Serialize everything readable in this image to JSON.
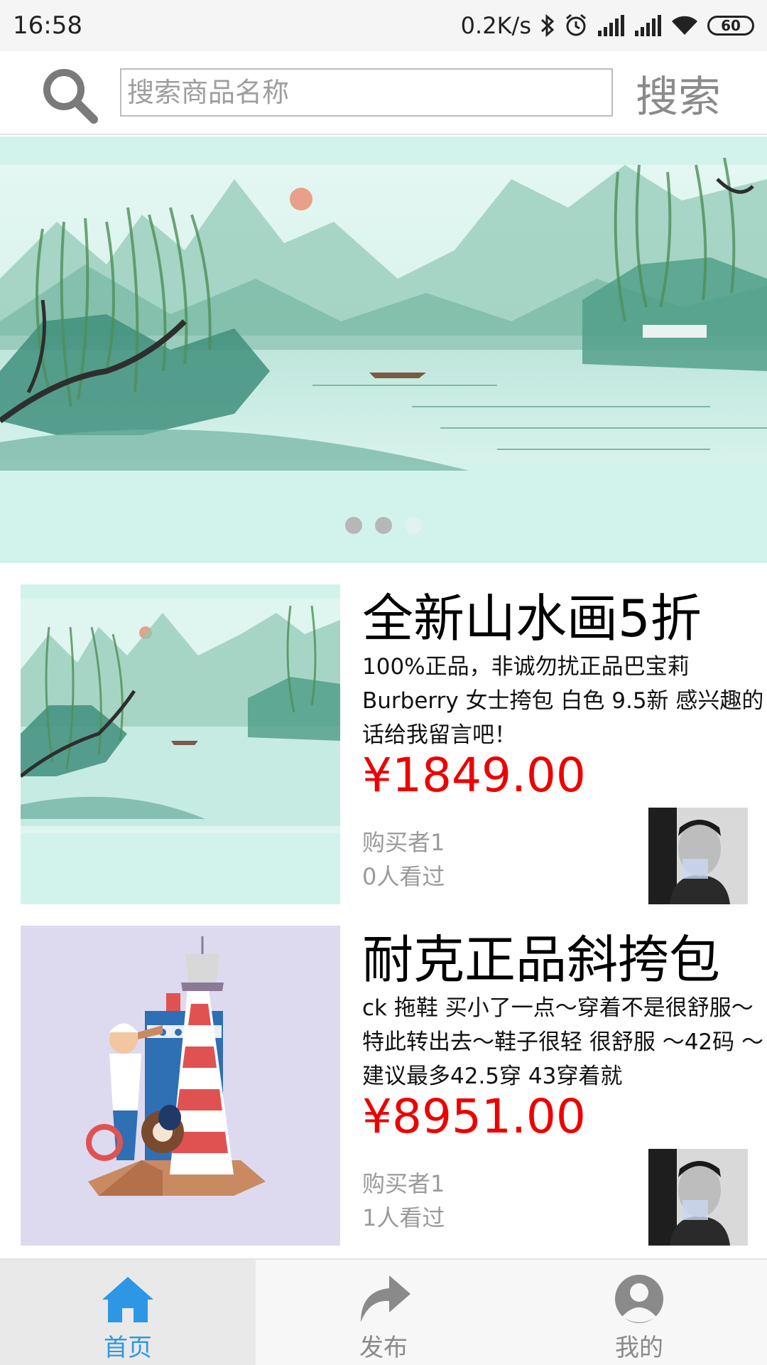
{
  "status_bar": {
    "time": "16:58",
    "network_speed": "0.2K/s",
    "battery": "60",
    "icons": [
      "bluetooth-icon",
      "alarm-icon",
      "signal-icon",
      "signal-icon",
      "wifi-icon",
      "battery-icon"
    ]
  },
  "search": {
    "placeholder": "搜索商品名称",
    "value": "",
    "button_label": "搜索",
    "icon": "search-icon"
  },
  "banner": {
    "slide_count": 3,
    "active_index": 1
  },
  "products": [
    {
      "title": "全新山水画5折",
      "description": "100%正品，非诚勿扰正品巴宝莉Burberry 女士挎包 白色 9.5新 感兴趣的话给我留言吧！",
      "price": "¥1849.00",
      "buyer": "购买者1",
      "views": "0人看过"
    },
    {
      "title": "耐克正品斜挎包",
      "description": "ck 拖鞋 买小了一点～穿着不是很舒服～特此转出去～鞋子很轻 很舒服 ～42码 ～建议最多42.5穿 43穿着就",
      "price": "¥8951.00",
      "buyer": "购买者1",
      "views": "1人看过"
    }
  ],
  "bottom_nav": {
    "items": [
      {
        "label": "首页",
        "icon": "home-icon",
        "active": true
      },
      {
        "label": "发布",
        "icon": "share-arrow-icon",
        "active": false
      },
      {
        "label": "我的",
        "icon": "user-icon",
        "active": false
      }
    ]
  },
  "colors": {
    "price": "#ee0000",
    "nav_active": "#2d97e6",
    "nav_inactive": "#8a8a8a",
    "banner_bg": "#d2f3ec"
  }
}
